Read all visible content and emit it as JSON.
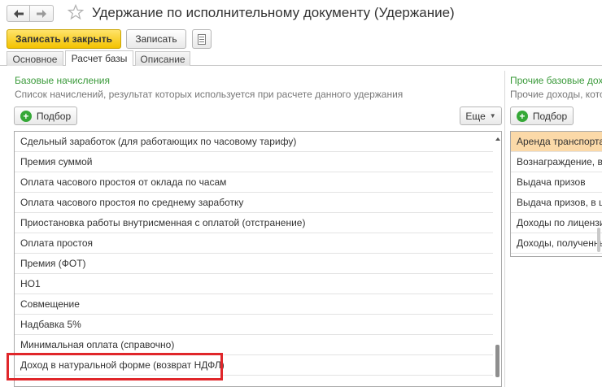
{
  "window": {
    "title": "Удержание по исполнительному документу (Удержание)",
    "icons": {
      "back": "arrow-left-icon",
      "forward": "arrow-right-icon",
      "favorite": "star-icon"
    }
  },
  "toolbar": {
    "save_close_label": "Записать и закрыть",
    "save_label": "Записать",
    "list_icon": "list-icon"
  },
  "tabs": [
    {
      "label": "Основное"
    },
    {
      "label": "Расчет базы"
    },
    {
      "label": "Описание"
    }
  ],
  "left_panel": {
    "title": "Базовые начисления",
    "hint": "Список начислений, результат которых используется при расчете данного удержания",
    "pick_label": "Подбор",
    "more_label": "Еще",
    "items": [
      "Сдельный заработок (для работающих по часовому тарифу)",
      "Премия суммой",
      "Оплата часового простоя от оклада по часам",
      "Оплата часового простоя по среднему заработку",
      "Приостановка работы внутрисменная с оплатой (отстранение)",
      "Оплата простоя",
      "Премия (ФОТ)",
      "НО1",
      "Совмещение",
      "Надбавка 5%",
      "Минимальная оплата (справочно)",
      "Доход в натуральной форме (возврат НДФЛ)"
    ],
    "highlighted_item": "Доход в натуральной форме (возврат НДФЛ)"
  },
  "right_panel": {
    "title": "Прочие базовые дохо",
    "hint": "Прочие доходы, котор",
    "pick_label": "Подбор",
    "items": [
      "Аренда транспорта",
      "Вознаграждение, вы",
      "Выдача призов",
      "Выдача призов, в це",
      "Доходы по лицензио",
      "Доходы, полученны"
    ],
    "selected_item": "Аренда транспорта"
  },
  "colors": {
    "accent_yellow": "#f3c200",
    "group_green": "#3a9a3a",
    "selection": "#fbd9a8",
    "highlight_red": "#e0262a"
  }
}
